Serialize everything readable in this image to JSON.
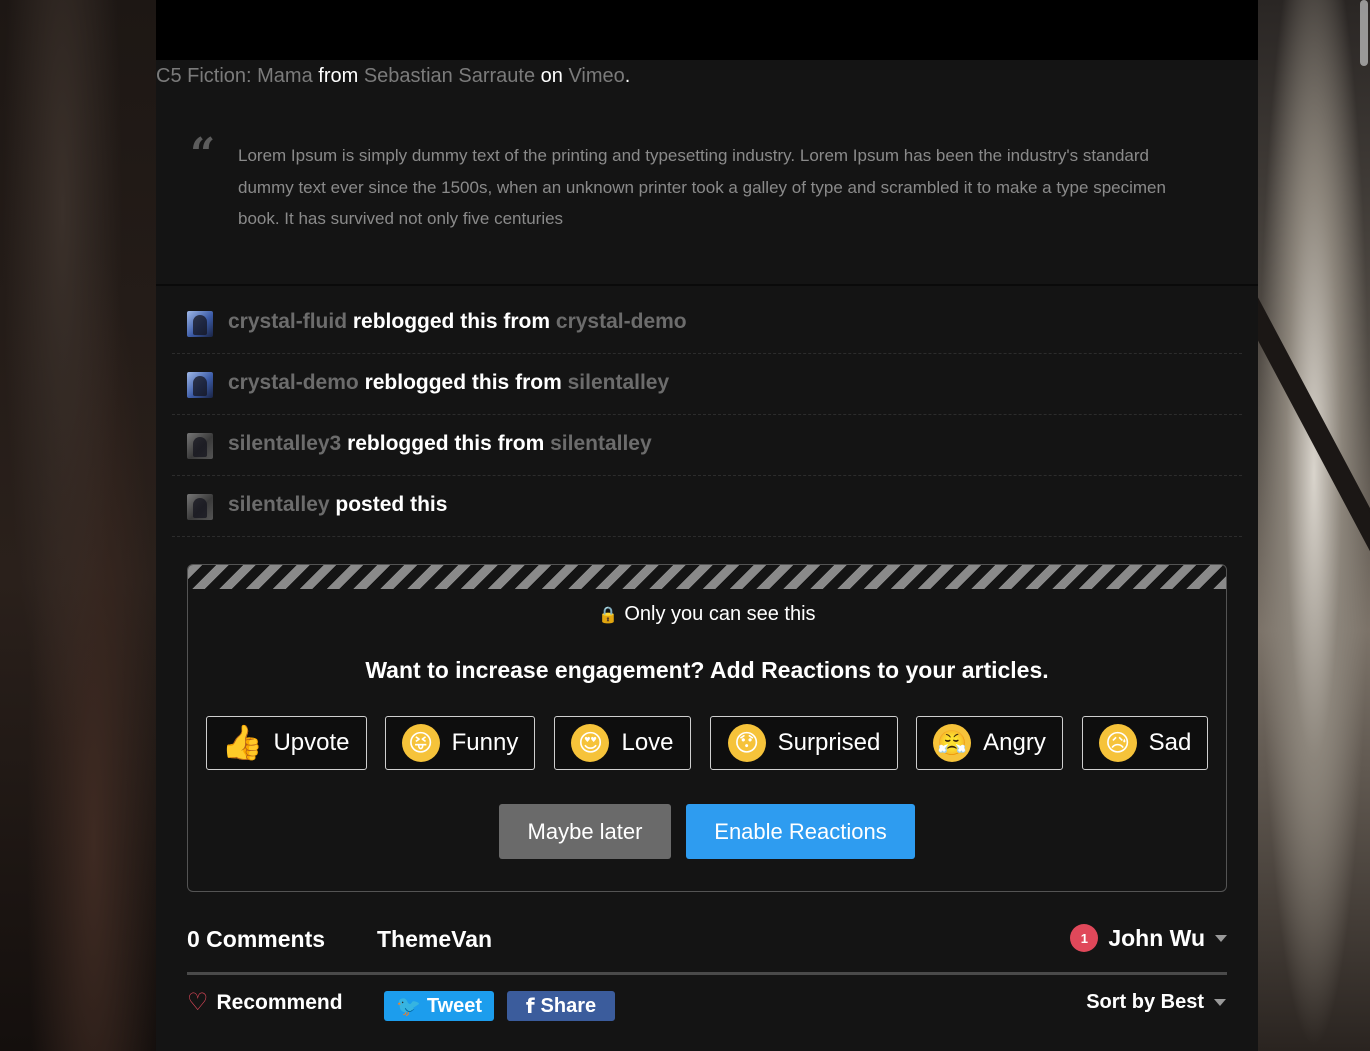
{
  "caption": {
    "title_link": "C5 Fiction: Mama",
    "from_text": "from",
    "author_link": "Sebastian Sarraute",
    "on_text": "on",
    "site_link": "Vimeo",
    "period": "."
  },
  "quote": {
    "mark": "“",
    "text": "Lorem Ipsum is simply dummy text of the printing and typesetting industry. Lorem Ipsum has been the industry's standard dummy text ever since the 1500s, when an unknown printer took a galley of type and scrambled it to make a type specimen book. It has survived not only five centuries"
  },
  "notes": [
    {
      "user": "crystal-fluid",
      "action": "reblogged this from",
      "source": "crystal-demo",
      "avatar": "blue"
    },
    {
      "user": "crystal-demo",
      "action": "reblogged this from",
      "source": "silentalley",
      "avatar": "blue"
    },
    {
      "user": "silentalley3",
      "action": "reblogged this from",
      "source": "silentalley",
      "avatar": "gray"
    },
    {
      "user": "silentalley",
      "action": "posted this",
      "source": "",
      "avatar": "gray"
    }
  ],
  "reactions_prompt": {
    "private_notice": "Only you can see this",
    "lock_icon": "lock-icon",
    "headline": "Want to increase engagement? Add Reactions to your articles.",
    "reactions": [
      {
        "label": "Upvote",
        "emoji": "👍",
        "icon": "thumbs-up-icon"
      },
      {
        "label": "Funny",
        "emoji": "😝",
        "icon": "funny-face-icon"
      },
      {
        "label": "Love",
        "emoji": "😍",
        "icon": "heart-eyes-icon"
      },
      {
        "label": "Surprised",
        "emoji": "😯",
        "icon": "surprised-face-icon"
      },
      {
        "label": "Angry",
        "emoji": "😤",
        "icon": "angry-face-icon"
      },
      {
        "label": "Sad",
        "emoji": "😥",
        "icon": "sad-face-icon"
      }
    ],
    "maybe_later_label": "Maybe later",
    "enable_label": "Enable Reactions",
    "colors": {
      "enable": "#2e9cf0",
      "later": "#6a6a6a"
    }
  },
  "comments": {
    "count_label": "0 Comments",
    "forum_name": "ThemeVan",
    "user_name": "John Wu",
    "notification_count": "1",
    "recommend_label": "Recommend",
    "tweet_label": "Tweet",
    "share_label": "Share",
    "sort_label": "Sort by Best",
    "colors": {
      "twitter": "#1c9ded",
      "facebook": "#3b5c9c",
      "badge": "#e0485a"
    }
  }
}
